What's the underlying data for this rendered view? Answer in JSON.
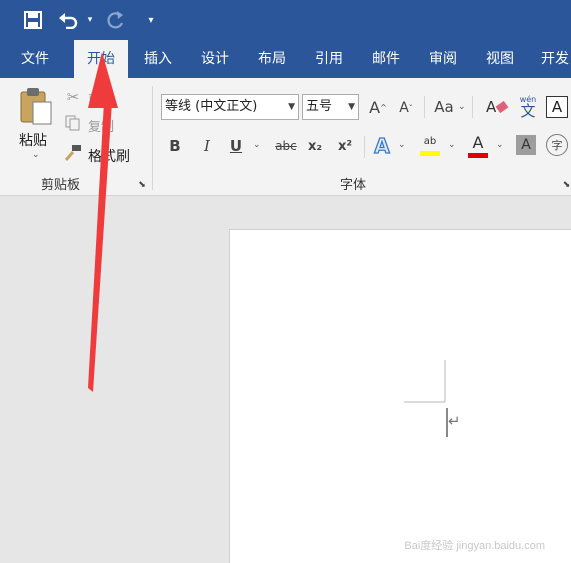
{
  "colors": {
    "titlebar": "#2b579a",
    "ribbon": "#f3f3f3",
    "accent_red": "#e03030",
    "highlight_yellow": "#ffff00",
    "font_red": "#e00000"
  },
  "tabs": [
    "文件",
    "开始",
    "插入",
    "设计",
    "布局",
    "引用",
    "邮件",
    "审阅",
    "视图",
    "开发"
  ],
  "clipboard": {
    "paste": "粘贴",
    "cut": "剪切",
    "copy": "复制",
    "format_painter": "格式刷",
    "group_label": "剪贴板"
  },
  "font": {
    "font_name": "等线 (中文正文)",
    "font_size": "五号",
    "grow": "A",
    "shrink": "A",
    "change_case": "Aa",
    "phonetic": "wén",
    "phonetic_char": "文",
    "char_border": "A",
    "bold": "B",
    "italic": "I",
    "underline": "U",
    "strikethrough": "abc",
    "subscript": "x₂",
    "superscript": "x²",
    "text_effects": "A",
    "highlight": "ab",
    "font_color": "A",
    "char_shading": "A",
    "enclose": "字",
    "group_label": "字体"
  },
  "watermark": "Bai度经验 jingyan.baidu.com"
}
